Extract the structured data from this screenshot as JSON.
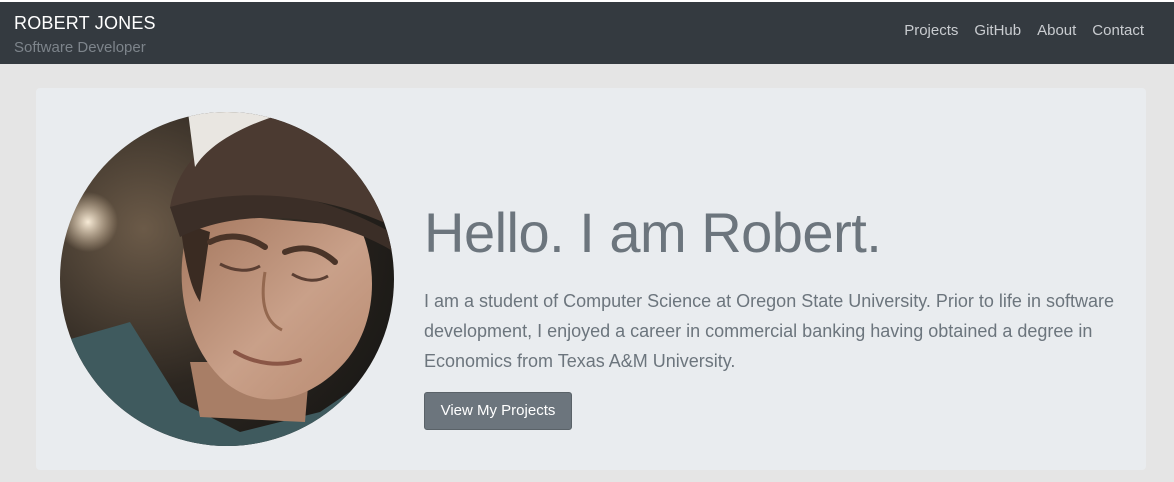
{
  "brand": {
    "name": "ROBERT JONES",
    "subtitle": "Software Developer"
  },
  "nav": {
    "items": [
      "Projects",
      "GitHub",
      "About",
      "Contact"
    ]
  },
  "hero": {
    "title": "Hello. I am Robert.",
    "text": "I am a student of Computer Science at Oregon State University. Prior to life in software development, I enjoyed a career in commercial banking having obtained a degree in Economics from Texas A&M University.",
    "button_label": "View My Projects",
    "avatar_icon": "profile-photo"
  },
  "colors": {
    "navbar": "#343a40",
    "hero_bg": "#e9ecef",
    "text_muted": "#6c757d",
    "button": "#6c757d"
  }
}
